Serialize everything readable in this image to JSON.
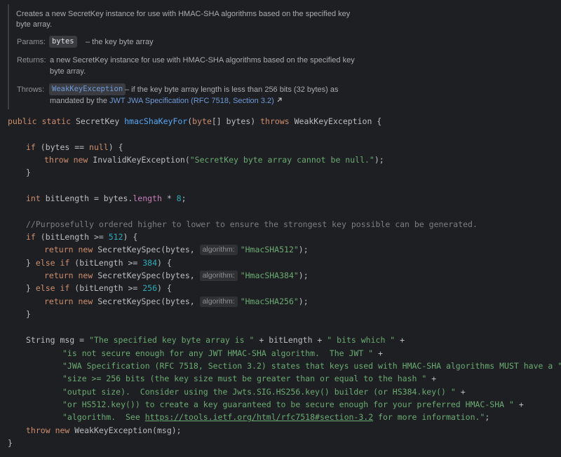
{
  "doc": {
    "summary_line1": "Creates a new SecretKey instance for use with HMAC-SHA algorithms based on the specified key",
    "summary_line2": "byte array.",
    "params_label": "Params:",
    "param_name": "bytes",
    "param_desc": "– the key byte array",
    "returns_label": "Returns:",
    "returns_line1": "a new SecretKey instance for use with HMAC-SHA algorithms based on the specified key",
    "returns_line2": "byte array.",
    "throws_label": "Throws:",
    "throws_exception": "WeakKeyException",
    "throws_line1": "– if the key byte array length is less than 256 bits (32 bytes) as",
    "throws_line2_prefix": "mandated by the ",
    "throws_link": "JWT JWA Specification (RFC 7518, Section 3.2)",
    "link_icon": "external-link-arrow-icon"
  },
  "code": {
    "sig_public": "public",
    "sig_static": "static",
    "sig_return": "SecretKey",
    "sig_method": "hmacShaKeyFor",
    "sig_open": "(",
    "sig_byte": "byte",
    "sig_params": "[] bytes) ",
    "sig_throws": "throws",
    "sig_end": " WeakKeyException {",
    "if_kw": "if",
    "if_cond_a": " (bytes == ",
    "null_kw": "null",
    "if_cond_b": ") {",
    "throw_kw": "throw",
    "new_kw": "new",
    "invalid_ex": " InvalidKeyException(",
    "invalid_msg": "\"SecretKey byte array cannot be null.\"",
    "invalid_end": ");",
    "close_brace": "}",
    "int_kw": "int",
    "bitlen_a": " bitLength = bytes.",
    "length_field": "length",
    "bitlen_b": " * ",
    "bitlen_num": "8",
    "bitlen_end": ";",
    "comment": "//Purposefully ordered higher to lower to ensure the strongest key possible can be generated.",
    "if1_a": " (bitLength >= ",
    "n512": "512",
    "brace_open": ") {",
    "ret_kw": "return",
    "spec_call": " SecretKeySpec(bytes, ",
    "hint_algorithm": "algorithm:",
    "alg512": "\"HmacSHA512\"",
    "alg384": "\"HmacSHA384\"",
    "alg256": "\"HmacSHA256\"",
    "call_end": ");",
    "else_close": "} ",
    "else_kw": "else",
    "n384": "384",
    "n256": "256",
    "string_type": "String msg = ",
    "msg1": "\"The specified key byte array is \"",
    "plus_bitlen": " + bitLength + ",
    "msg1b": "\" bits which \"",
    "plus": " +",
    "msg2": "\"is not secure enough for any JWT HMAC-SHA algorithm.  The JWT \"",
    "msg3": "\"JWA Specification (RFC 7518, Section 3.2) states that keys used with HMAC-SHA algorithms MUST have a \"",
    "msg4": "\"size >= 256 bits (the key size must be greater than or equal to the hash \"",
    "msg5": "\"output size).  Consider using the Jwts.SIG.HS256.key() builder (or HS384.key() \"",
    "msg6": "\"or HS512.key()) to create a key guaranteed to be secure enough for your preferred HMAC-SHA \"",
    "msg7a": "\"algorithm.  See ",
    "msg7_url": "https://tools.ietf.org/html/rfc7518#section-3.2",
    "msg7b": " for more information.\"",
    "semi": ";",
    "throw_weak": " WeakKeyException(msg);",
    "final_brace": "}"
  }
}
